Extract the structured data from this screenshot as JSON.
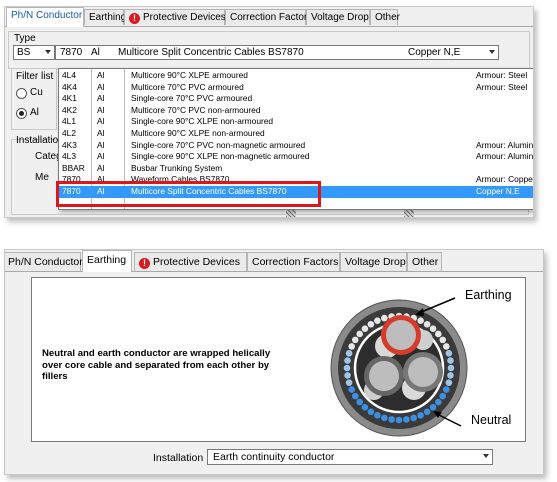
{
  "top_panel": {
    "tabs": [
      {
        "label": "Ph/N Conductor",
        "active": true
      },
      {
        "label": "Earthing"
      },
      {
        "label": "Protective Devices",
        "warning": true
      },
      {
        "label": "Correction Factors"
      },
      {
        "label": "Voltage Drop"
      },
      {
        "label": "Other"
      }
    ],
    "type_label": "Type",
    "type_standard": "BS",
    "selected": {
      "code": "7870",
      "material": "Al",
      "description": "Multicore Split Concentric Cables BS7870",
      "note": "Copper N,E"
    },
    "filter_label": "Filter list",
    "radio_cu": "Cu",
    "radio_al": "Al",
    "installation_label": "Installation",
    "category_label": "Categ",
    "method_label": "Me",
    "dropdown_rows": [
      {
        "code": "4L4",
        "material": "Al",
        "description": "Multicore 90°C XLPE armoured",
        "note": "Armour: Steel"
      },
      {
        "code": "4K4",
        "material": "Al",
        "description": "Multicore 70°C PVC armoured",
        "note": "Armour: Steel"
      },
      {
        "code": "4K1",
        "material": "Al",
        "description": "Single-core 70°C PVC armoured",
        "note": ""
      },
      {
        "code": "4K2",
        "material": "Al",
        "description": "Multicore 70°C PVC non-armoured",
        "note": ""
      },
      {
        "code": "4L1",
        "material": "Al",
        "description": "Single-core 90°C XLPE non-armoured",
        "note": ""
      },
      {
        "code": "4L2",
        "material": "Al",
        "description": "Multicore 90°C XLPE non-armoured",
        "note": ""
      },
      {
        "code": "4K3",
        "material": "Al",
        "description": "Single-core 70°C PVC non-magnetic armoured",
        "note": "Armour: Aluminium"
      },
      {
        "code": "4L3",
        "material": "Al",
        "description": "Single-core 90°C XLPE non-magnetic armoured",
        "note": "Armour: Aluminium"
      },
      {
        "code": "BBAR",
        "material": "Al",
        "description": "Busbar Trunking System",
        "note": ""
      },
      {
        "code": "7870",
        "material": "Al",
        "description": "Waveform Cables BS7870",
        "note": "Armour: Copper"
      },
      {
        "code": "7870",
        "material": "Al",
        "description": "Multicore Split Concentric Cables BS7870",
        "note": "Copper N,E",
        "selected": true
      }
    ]
  },
  "bottom_panel": {
    "tabs": [
      {
        "label": "Ph/N Conductor"
      },
      {
        "label": "Earthing",
        "active": true
      },
      {
        "label": "Protective Devices",
        "warning": true
      },
      {
        "label": "Correction Factors"
      },
      {
        "label": "Voltage Drop"
      },
      {
        "label": "Other"
      }
    ],
    "description": "Neutral and earth conductor are wrapped helically over core cable and separated from each other by fillers",
    "callout_earthing": "Earthing",
    "callout_neutral": "Neutral",
    "installation_label": "Installation",
    "installation_value": "Earth continuity conductor"
  },
  "colors": {
    "accent": "#3399ff",
    "highlight_border": "#e0141b",
    "warning": "#d71920"
  }
}
